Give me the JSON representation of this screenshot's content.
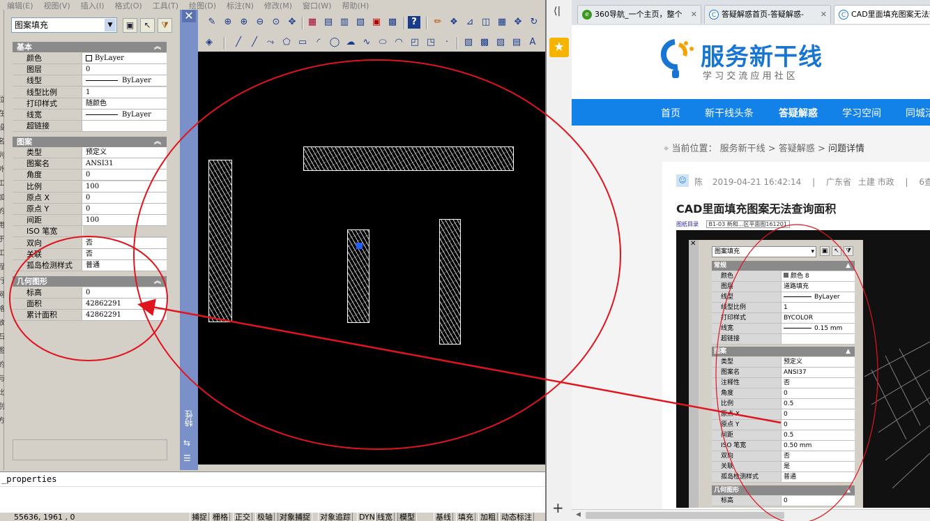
{
  "cad": {
    "menu": [
      "编辑(E)",
      "视图(V)",
      "插入(I)",
      "格式(O)",
      "工具(T)",
      "绘图(D)",
      "标注(N)",
      "修改(M)",
      "窗口(W)",
      "帮助(H)"
    ],
    "palette": {
      "selector": "图案填充",
      "sections": {
        "basic": "基本",
        "pattern": "图案",
        "geometry": "几何图形"
      },
      "basic_rows": [
        {
          "k": "颜色",
          "v": "ByLayer"
        },
        {
          "k": "图层",
          "v": "0"
        },
        {
          "k": "线型",
          "v": "ByLayer"
        },
        {
          "k": "线型比例",
          "v": "1"
        },
        {
          "k": "打印样式",
          "v": "随颜色"
        },
        {
          "k": "线宽",
          "v": "ByLayer"
        },
        {
          "k": "超链接",
          "v": ""
        }
      ],
      "pattern_rows": [
        {
          "k": "类型",
          "v": "预定义"
        },
        {
          "k": "图案名",
          "v": "ANSI31"
        },
        {
          "k": "角度",
          "v": "0"
        },
        {
          "k": "比例",
          "v": "100"
        },
        {
          "k": "原点 X",
          "v": "0"
        },
        {
          "k": "原点 Y",
          "v": "0"
        },
        {
          "k": "间距",
          "v": "100"
        },
        {
          "k": "ISO 笔宽",
          "v": ""
        },
        {
          "k": "双向",
          "v": "否"
        },
        {
          "k": "关联",
          "v": "否"
        },
        {
          "k": "孤岛检测样式",
          "v": "普通"
        }
      ],
      "geometry_rows": [
        {
          "k": "标高",
          "v": "0"
        },
        {
          "k": "面积",
          "v": "42862291"
        },
        {
          "k": "累计面积",
          "v": "42862291"
        }
      ],
      "strip_label": "特性"
    },
    "command_line": "_properties",
    "coords": "55636, 1961 , 0",
    "status_buttons": [
      "捕捉",
      "栅格",
      "正交",
      "极轴",
      "对象捕捉",
      "对象追踪",
      "DYN",
      "线宽",
      "模型",
      "基线",
      "填充",
      "加粗",
      "动态标注"
    ],
    "left_edge_chars": [
      "位",
      "在",
      "设",
      "名",
      "列",
      "外",
      "工",
      "加",
      "的",
      "用",
      "于",
      "工",
      "程",
      "行",
      "网",
      "格",
      "放",
      "石",
      "图",
      "的",
      "与",
      "比",
      "别",
      "方"
    ]
  },
  "browser": {
    "tabs": [
      {
        "label": "360导航_一个主页，整个",
        "icon": "360-icon"
      },
      {
        "label": "答疑解惑首页-答疑解惑-",
        "icon": "site-icon"
      },
      {
        "label": "CAD里面填充图案无法查询",
        "icon": "site-icon"
      }
    ],
    "logo_title": "服务新干线",
    "logo_sub": "学 习 交 流 应 用 社 区",
    "nav": [
      "首页",
      "新干线头条",
      "答疑解惑",
      "学习空间",
      "同城活"
    ],
    "breadcrumb": {
      "prefix": "当前位置：",
      "items": [
        "服务新干线",
        ">",
        "答疑解惑",
        ">",
        "问题详情"
      ]
    },
    "meta": {
      "user": "陈",
      "date": "2019-04-21 16:42:14",
      "sep": "|",
      "location": "广东省",
      "category": "土建 市政",
      "views": "6查"
    },
    "question_title": "CAD里面填充图案无法查询面积",
    "embedded": {
      "header_strip": [
        "图纸目录",
        "B1-03 新和...区平面图161201"
      ],
      "selector": "图案填充",
      "sections": [
        "常规",
        "图案",
        "几何图形"
      ],
      "general_rows": [
        {
          "k": "颜色",
          "v": "颜色 8"
        },
        {
          "k": "图层",
          "v": "道路填充"
        },
        {
          "k": "线型",
          "v": "ByLayer"
        },
        {
          "k": "线型比例",
          "v": "1"
        },
        {
          "k": "打印样式",
          "v": "BYCOLOR"
        },
        {
          "k": "线宽",
          "v": "0.15 mm"
        },
        {
          "k": "超链接",
          "v": ""
        }
      ],
      "pattern_rows": [
        {
          "k": "类型",
          "v": "预定义"
        },
        {
          "k": "图案名",
          "v": "ANSI37"
        },
        {
          "k": "注释性",
          "v": "否"
        },
        {
          "k": "角度",
          "v": "0"
        },
        {
          "k": "比例",
          "v": "0.5"
        },
        {
          "k": "原点 X",
          "v": "0"
        },
        {
          "k": "原点 Y",
          "v": "0"
        },
        {
          "k": "间距",
          "v": "0.5"
        },
        {
          "k": "ISO 笔宽",
          "v": "0.50 mm"
        },
        {
          "k": "双向",
          "v": "否"
        },
        {
          "k": "关联",
          "v": "是"
        },
        {
          "k": "孤岛检测样式",
          "v": "普通"
        }
      ],
      "geometry_rows": [
        {
          "k": "标高",
          "v": "0"
        }
      ]
    }
  },
  "colors": {
    "annotation_red": "#e0141e",
    "nav_blue": "#1382e8",
    "logo_blue": "#1876d2",
    "palette_strip": "#7a90c8"
  }
}
